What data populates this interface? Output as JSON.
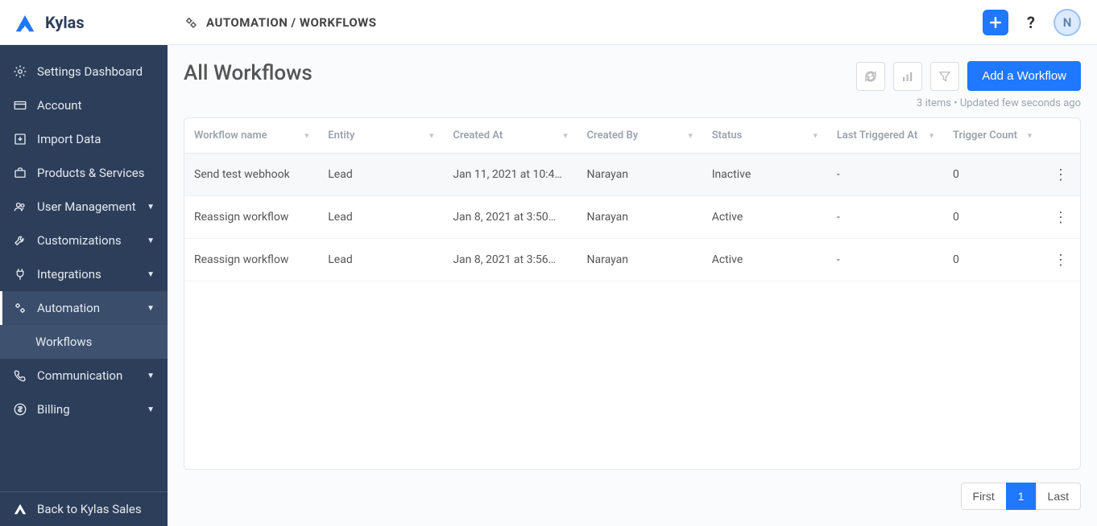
{
  "brand": {
    "name": "Kylas"
  },
  "breadcrumb": {
    "text": "AUTOMATION / WORKFLOWS"
  },
  "topbar": {
    "avatar_initial": "N"
  },
  "sidebar": {
    "items": [
      {
        "label": "Settings Dashboard",
        "icon": "gear",
        "expandable": false
      },
      {
        "label": "Account",
        "icon": "card",
        "expandable": false
      },
      {
        "label": "Import Data",
        "icon": "import",
        "expandable": false
      },
      {
        "label": "Products & Services",
        "icon": "briefcase",
        "expandable": false
      },
      {
        "label": "User Management",
        "icon": "users",
        "expandable": true
      },
      {
        "label": "Customizations",
        "icon": "wrench",
        "expandable": true
      },
      {
        "label": "Integrations",
        "icon": "plug",
        "expandable": true
      },
      {
        "label": "Automation",
        "icon": "gears",
        "expandable": true,
        "active": true
      },
      {
        "label": "Communication",
        "icon": "phone",
        "expandable": true
      },
      {
        "label": "Billing",
        "icon": "dollar",
        "expandable": true
      }
    ],
    "sub_item": {
      "label": "Workflows"
    },
    "footer": {
      "label": "Back to Kylas Sales",
      "icon": "logo-small"
    }
  },
  "page": {
    "title": "All Workflows",
    "add_button": "Add a Workflow",
    "status": {
      "count": "3 items",
      "updated": "Updated few seconds ago"
    }
  },
  "table": {
    "headers": [
      "Workflow name",
      "Entity",
      "Created At",
      "Created By",
      "Status",
      "Last Triggered At",
      "Trigger Count"
    ],
    "rows": [
      {
        "name": "Send test webhook",
        "entity": "Lead",
        "created_at": "Jan 11, 2021 at 10:4…",
        "created_by": "Narayan",
        "status": "Inactive",
        "last_triggered": "-",
        "trigger_count": "0"
      },
      {
        "name": "Reassign workflow",
        "entity": "Lead",
        "created_at": "Jan 8, 2021 at 3:50…",
        "created_by": "Narayan",
        "status": "Active",
        "last_triggered": "-",
        "trigger_count": "0"
      },
      {
        "name": "Reassign workflow",
        "entity": "Lead",
        "created_at": "Jan 8, 2021 at 3:56…",
        "created_by": "Narayan",
        "status": "Active",
        "last_triggered": "-",
        "trigger_count": "0"
      }
    ]
  },
  "pagination": {
    "first": "First",
    "current": "1",
    "last": "Last"
  }
}
